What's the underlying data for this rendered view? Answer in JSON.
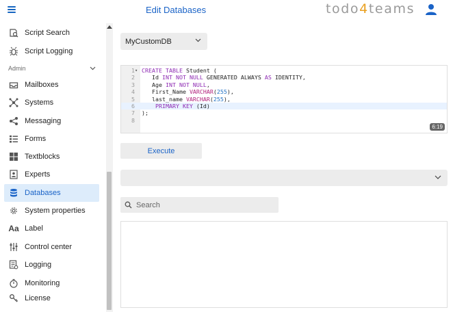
{
  "header": {
    "menu_icon": "hamburger-icon",
    "title": "Edit Databases",
    "brand_prefix": "todo",
    "brand_number": "4",
    "brand_suffix": "teams",
    "user_icon": "user-icon",
    "accent": "#1a63c7",
    "brand_accent": "#e9a020"
  },
  "sidebar": {
    "items_top": [
      {
        "label": "Script Search",
        "icon": "script-search-icon"
      },
      {
        "label": "Script Logging",
        "icon": "bug-icon"
      }
    ],
    "section": {
      "label": "Admin",
      "icon": "chevron-down-icon"
    },
    "items": [
      {
        "label": "Mailboxes",
        "icon": "inbox-icon"
      },
      {
        "label": "Systems",
        "icon": "network-icon"
      },
      {
        "label": "Messaging",
        "icon": "share-icon"
      },
      {
        "label": "Forms",
        "icon": "form-list-icon"
      },
      {
        "label": "Textblocks",
        "icon": "grid-icon"
      },
      {
        "label": "Experts",
        "icon": "contact-card-icon"
      },
      {
        "label": "Databases",
        "icon": "database-icon",
        "active": true
      },
      {
        "label": "System properties",
        "icon": "gear-icon"
      },
      {
        "label": "Label",
        "icon": "text-aa-icon"
      },
      {
        "label": "Control center",
        "icon": "sliders-icon"
      },
      {
        "label": "Logging",
        "icon": "log-document-icon"
      },
      {
        "label": "Monitoring",
        "icon": "stopwatch-icon"
      },
      {
        "label": "License",
        "icon": "key-icon"
      }
    ],
    "active_color": "#ddecfb"
  },
  "main": {
    "database_select": {
      "value": "MyCustomDB"
    },
    "editor": {
      "lines": [
        {
          "n": "1",
          "text": "CREATE TABLE Student ("
        },
        {
          "n": "2",
          "text": "   Id INT NOT NULL GENERATED ALWAYS AS IDENTITY,"
        },
        {
          "n": "3",
          "text": "   Age INT NOT NULL,"
        },
        {
          "n": "4",
          "text": "   First_Name VARCHAR(255),"
        },
        {
          "n": "5",
          "text": "   last_name VARCHAR(255),"
        },
        {
          "n": "6",
          "text": "    PRIMARY KEY (Id)"
        },
        {
          "n": "7",
          "text": ");"
        },
        {
          "n": "8",
          "text": ""
        }
      ],
      "cursor_position": "6:19"
    },
    "execute_button": "Execute",
    "result_select": {
      "value": ""
    },
    "search": {
      "placeholder": "Search"
    }
  }
}
